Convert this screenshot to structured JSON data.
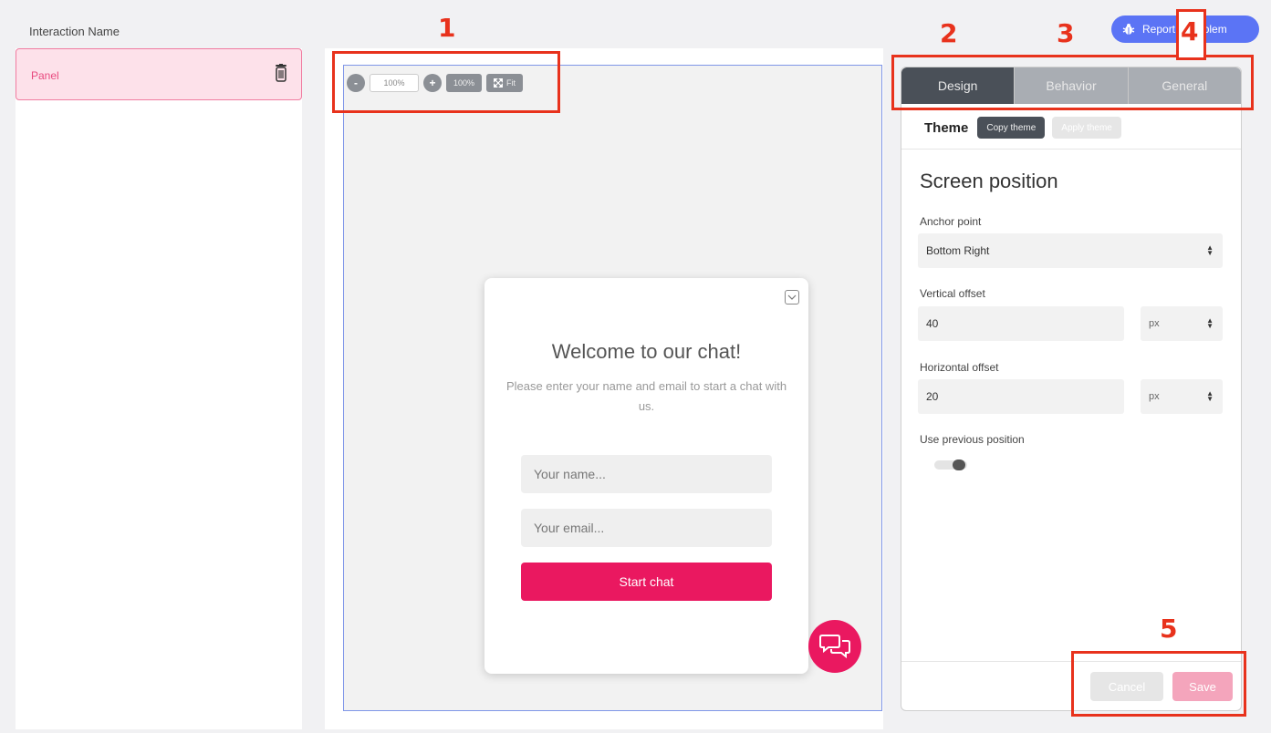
{
  "left": {
    "title": "Interaction Name",
    "items": [
      {
        "label": "Panel"
      }
    ]
  },
  "zoom": {
    "minus": "-",
    "value": "100%",
    "plus": "+",
    "reset_label": "100%",
    "fit_label": "Fit"
  },
  "chat": {
    "title": "Welcome to our chat!",
    "subtitle": "Please enter your name and email to start a chat with us.",
    "name_placeholder": "Your name...",
    "email_placeholder": "Your email...",
    "start_label": "Start chat"
  },
  "tabs": [
    {
      "label": "Design",
      "active": true
    },
    {
      "label": "Behavior",
      "active": false
    },
    {
      "label": "General",
      "active": false
    }
  ],
  "theme": {
    "label": "Theme",
    "copy_label": "Copy theme",
    "apply_label": "Apply theme"
  },
  "screen_position": {
    "title": "Screen position",
    "anchor_label": "Anchor point",
    "anchor_value": "Bottom Right",
    "vertical_label": "Vertical offset",
    "vertical_value": "40",
    "vertical_unit": "px",
    "horizontal_label": "Horizontal offset",
    "horizontal_value": "20",
    "horizontal_unit": "px",
    "previous_label": "Use previous position",
    "previous_enabled": true
  },
  "footer": {
    "cancel_label": "Cancel",
    "save_label": "Save"
  },
  "report": {
    "label": "Report a problem"
  },
  "annotations": [
    "1",
    "2",
    "3",
    "4",
    "5"
  ],
  "colors": {
    "accent_pink": "#ea1860",
    "annotation_red": "#e8321c",
    "tab_active": "#4a5058",
    "report_blue": "#5b74f5"
  }
}
